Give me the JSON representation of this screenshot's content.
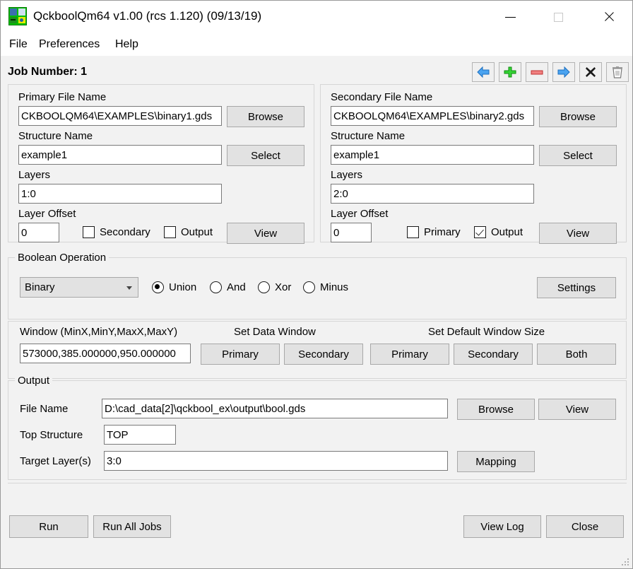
{
  "window": {
    "title": "QckboolQm64 v1.00 (rcs 1.120) (09/13/19)",
    "app_icon": "qckbool-app-icon",
    "controls": {
      "minimize": "minimize-icon",
      "maximize": "maximize-icon",
      "close": "close-icon"
    }
  },
  "menubar": {
    "items": [
      {
        "label": "File"
      },
      {
        "label": "Preferences"
      },
      {
        "label": "Help"
      }
    ]
  },
  "job": {
    "label": "Job Number: 1"
  },
  "toolbar": {
    "buttons": [
      {
        "name": "previous-job-button",
        "icon": "left-arrow-icon",
        "color": "#2f86e0"
      },
      {
        "name": "add-job-button",
        "icon": "plus-icon",
        "color": "#25b425"
      },
      {
        "name": "remove-job-button",
        "icon": "minus-icon",
        "color": "#e04a4a"
      },
      {
        "name": "next-job-button",
        "icon": "right-arrow-icon",
        "color": "#2f86e0"
      },
      {
        "name": "clear-job-button",
        "icon": "x-icon",
        "color": "#1a1a1a"
      },
      {
        "name": "delete-job-button",
        "icon": "trash-icon",
        "color": "#787878"
      }
    ]
  },
  "primary": {
    "file_name_label": "Primary File Name",
    "file_name_value": "CKBOOLQM64\\EXAMPLES\\binary1.gds",
    "browse_label": "Browse",
    "structure_name_label": "Structure Name",
    "structure_name_value": "example1",
    "select_label": "Select",
    "layers_label": "Layers",
    "layers_value": "1:0",
    "layer_offset_label": "Layer Offset",
    "layer_offset_value": "0",
    "checkbox_secondary_label": "Secondary",
    "checkbox_secondary_checked": false,
    "checkbox_output_label": "Output",
    "checkbox_output_checked": false,
    "view_label": "View"
  },
  "secondary": {
    "file_name_label": "Secondary File Name",
    "file_name_value": "CKBOOLQM64\\EXAMPLES\\binary2.gds",
    "browse_label": "Browse",
    "structure_name_label": "Structure Name",
    "structure_name_value": "example1",
    "select_label": "Select",
    "layers_label": "Layers",
    "layers_value": "2:0",
    "layer_offset_label": "Layer Offset",
    "layer_offset_value": "0",
    "checkbox_primary_label": "Primary",
    "checkbox_primary_checked": false,
    "checkbox_output_label": "Output",
    "checkbox_output_checked": true,
    "view_label": "View"
  },
  "boolean_operation": {
    "group_title": "Boolean Operation",
    "mode_value": "Binary",
    "mode_options": [
      "Binary"
    ],
    "radios": [
      {
        "label": "Union",
        "selected": true
      },
      {
        "label": "And",
        "selected": false
      },
      {
        "label": "Xor",
        "selected": false
      },
      {
        "label": "Minus",
        "selected": false
      }
    ],
    "settings_label": "Settings"
  },
  "window_section": {
    "window_label": "Window (MinX,MinY,MaxX,MaxY)",
    "window_value": "573000,385.000000,950.000000",
    "set_data_window_label": "Set Data Window",
    "set_data_primary_label": "Primary",
    "set_data_secondary_label": "Secondary",
    "set_default_window_size_label": "Set Default Window Size",
    "set_default_primary_label": "Primary",
    "set_default_secondary_label": "Secondary",
    "set_default_both_label": "Both"
  },
  "output": {
    "group_title": "Output",
    "file_name_label": "File Name",
    "file_name_value": "D:\\cad_data[2]\\qckbool_ex\\output\\bool.gds",
    "browse_label": "Browse",
    "view_label": "View",
    "top_structure_label": "Top Structure",
    "top_structure_value": "TOP",
    "target_layers_label": "Target Layer(s)",
    "target_layers_value": "3:0",
    "mapping_label": "Mapping"
  },
  "footer": {
    "run_label": "Run",
    "run_all_jobs_label": "Run All Jobs",
    "view_log_label": "View Log",
    "close_label": "Close"
  }
}
